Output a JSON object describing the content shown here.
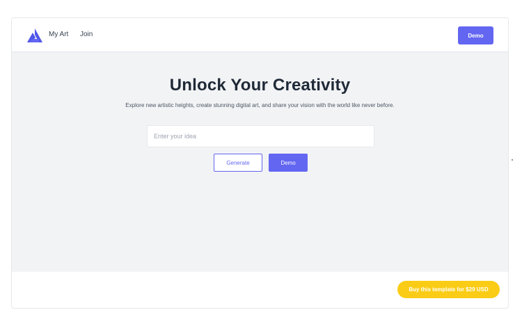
{
  "nav": {
    "logo_icon": "triangle-logo-icon",
    "brand_label": "My Art",
    "join_label": "Join",
    "demo_label": "Demo"
  },
  "hero": {
    "title": "Unlock Your Creativity",
    "subtitle": "Explore new artistic heights, create stunning digital art, and share your vision with the world like never before.",
    "input_placeholder": "Enter your idea",
    "input_value": "",
    "generate_label": "Generate",
    "demo_label": "Demo"
  },
  "footer": {
    "buy_label": "Buy this template for $29 USD"
  },
  "colors": {
    "accent": "#6366f1",
    "hero_background": "#f2f3f5",
    "buy_button": "#facc15",
    "logo": "#4f56e8"
  }
}
